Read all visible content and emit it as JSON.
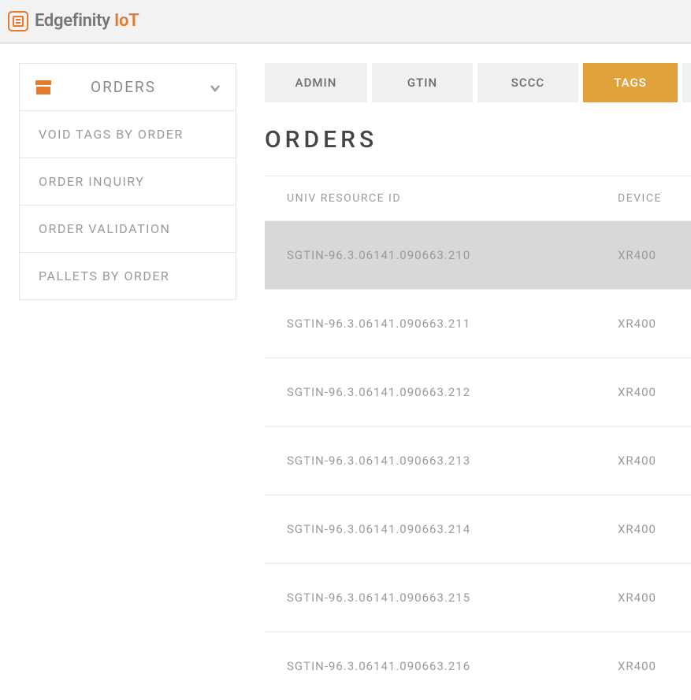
{
  "brand": {
    "name": "Edgefinity",
    "accent": "IoT"
  },
  "sidebar": {
    "header_label": "ORDERS",
    "items": [
      {
        "label": "VOID TAGS BY ORDER"
      },
      {
        "label": "ORDER INQUIRY"
      },
      {
        "label": "ORDER VALIDATION"
      },
      {
        "label": "PALLETS BY ORDER"
      }
    ]
  },
  "tabs": [
    {
      "label": "ADMIN",
      "active": false
    },
    {
      "label": "GTIN",
      "active": false
    },
    {
      "label": "SCCC",
      "active": false
    },
    {
      "label": "TAGS",
      "active": true
    }
  ],
  "page_title": "ORDERS",
  "table": {
    "columns": {
      "id": "UNIV RESOURCE ID",
      "device": "DEVICE"
    },
    "rows": [
      {
        "id": "SGTIN-96.3.06141.090663.210",
        "device": "XR400",
        "selected": true
      },
      {
        "id": "SGTIN-96.3.06141.090663.211",
        "device": "XR400",
        "selected": false
      },
      {
        "id": "SGTIN-96.3.06141.090663.212",
        "device": "XR400",
        "selected": false
      },
      {
        "id": "SGTIN-96.3.06141.090663.213",
        "device": "XR400",
        "selected": false
      },
      {
        "id": "SGTIN-96.3.06141.090663.214",
        "device": "XR400",
        "selected": false
      },
      {
        "id": "SGTIN-96.3.06141.090663.215",
        "device": "XR400",
        "selected": false
      },
      {
        "id": "SGTIN-96.3.06141.090663.216",
        "device": "XR400",
        "selected": false
      }
    ]
  }
}
